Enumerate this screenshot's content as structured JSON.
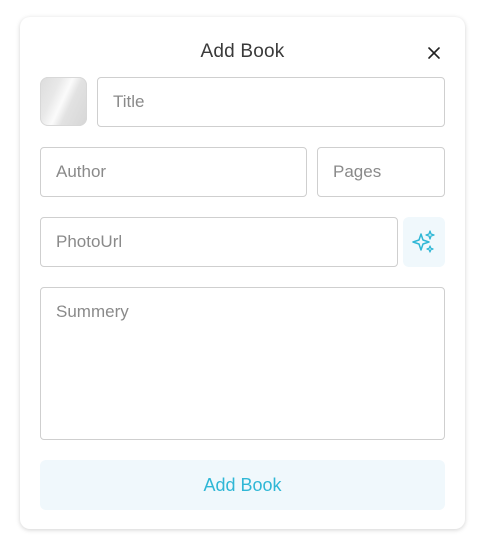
{
  "dialog": {
    "title": "Add Book",
    "close_icon": "close-icon"
  },
  "form": {
    "photo_preview": "image-placeholder",
    "title_placeholder": "Title",
    "author_placeholder": "Author",
    "pages_placeholder": "Pages",
    "photo_url_placeholder": "PhotoUrl",
    "generate_icon": "sparkles-icon",
    "summary_placeholder": "Summery",
    "submit_label": "Add Book"
  },
  "colors": {
    "accent": "#2fb7d6",
    "accent_bg": "#f0f8fc",
    "border": "#cfcfcf"
  }
}
